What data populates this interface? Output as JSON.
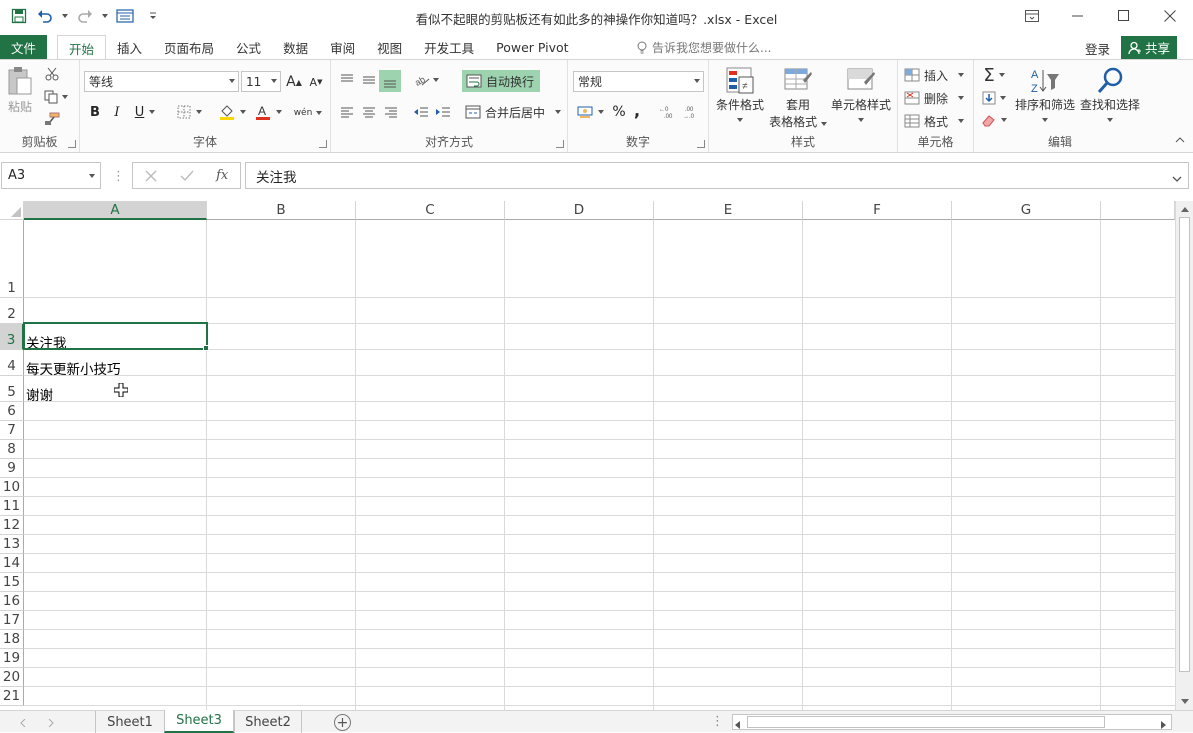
{
  "window": {
    "title": "看似不起眼的剪贴板还有如此多的神操作你知道吗？.xlsx - Excel",
    "controls": [
      "ribbon-display-icon",
      "minimize-icon",
      "maximize-icon",
      "close-icon"
    ]
  },
  "tabs": {
    "file": "文件",
    "items": [
      "开始",
      "插入",
      "页面布局",
      "公式",
      "数据",
      "审阅",
      "视图",
      "开发工具",
      "Power Pivot"
    ],
    "active_index": 0,
    "tell_me": "告诉我您想要做什么...",
    "login": "登录",
    "share": "共享"
  },
  "ribbon": {
    "clipboard": {
      "paste": "粘贴",
      "label": "剪贴板"
    },
    "font": {
      "name": "等线",
      "size": "11",
      "bold": "B",
      "italic": "I",
      "underline": "U",
      "phonetic": "wén",
      "label": "字体"
    },
    "alignment": {
      "wrap": "自动换行",
      "merge": "合并后居中",
      "label": "对齐方式"
    },
    "number": {
      "format": "常规",
      "percent": "%",
      "comma": ",",
      "label": "数字"
    },
    "styles": {
      "conditional": "条件格式",
      "table1": "套用",
      "table2": "表格格式",
      "cell_styles": "单元格样式",
      "label": "样式"
    },
    "cells": {
      "insert": "插入",
      "delete": "删除",
      "format": "格式",
      "label": "单元格"
    },
    "editing": {
      "sort": "排序和筛选",
      "find": "查找和选择",
      "label": "编辑"
    },
    "accent": "#217346"
  },
  "formula_bar": {
    "name_box": "A3",
    "fx": "fx",
    "content": "关注我"
  },
  "grid": {
    "columns": [
      "A",
      "B",
      "C",
      "D",
      "E",
      "F",
      "G"
    ],
    "selected_column": "A",
    "rows": [
      "1",
      "2",
      "3",
      "4",
      "5",
      "6",
      "7",
      "8",
      "9",
      "10",
      "11",
      "12",
      "13",
      "14",
      "15",
      "16",
      "17",
      "18",
      "19",
      "20",
      "21"
    ],
    "selected_row": "3",
    "cells": {
      "A3": "关注我",
      "A4": "每天更新小技巧",
      "A5": "谢谢"
    }
  },
  "sheets": {
    "items": [
      "Sheet1",
      "Sheet3",
      "Sheet2"
    ],
    "active": "Sheet3",
    "add": "+"
  }
}
